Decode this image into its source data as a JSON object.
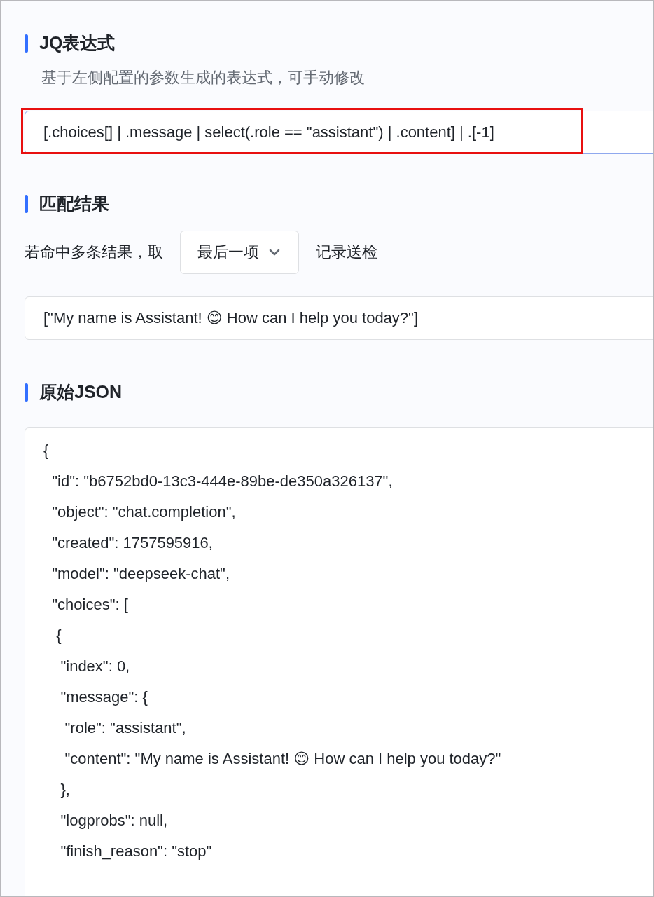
{
  "sections": [
    {
      "kind": "expression",
      "title": "JQ表达式",
      "description": "基于左侧配置的参数生成的表达式，可手动修改",
      "value": "[.choices[] | .message | select(.role == \"assistant\") | .content] | .[-1]",
      "highlighted": true
    },
    {
      "kind": "result",
      "title": "匹配结果",
      "prefix": "若命中多条结果，取",
      "select_value": "最后一项",
      "suffix": "记录送检",
      "value": "[\"My name is Assistant! 😊 How can I help you today?\"]"
    },
    {
      "kind": "raw",
      "title": "原始JSON",
      "lines": [
        "{",
        "  \"id\": \"b6752bd0-13c3-444e-89be-de350a326137\",",
        "  \"object\": \"chat.completion\",",
        "  \"created\": 1757595916,",
        "  \"model\": \"deepseek-chat\",",
        "  \"choices\": [",
        "   {",
        "    \"index\": 0,",
        "    \"message\": {",
        "     \"role\": \"assistant\",",
        "     \"content\": \"My name is Assistant! 😊 How can I help you today?\"",
        "    },",
        "    \"logprobs\": null,",
        "    \"finish_reason\": \"stop\""
      ]
    }
  ]
}
